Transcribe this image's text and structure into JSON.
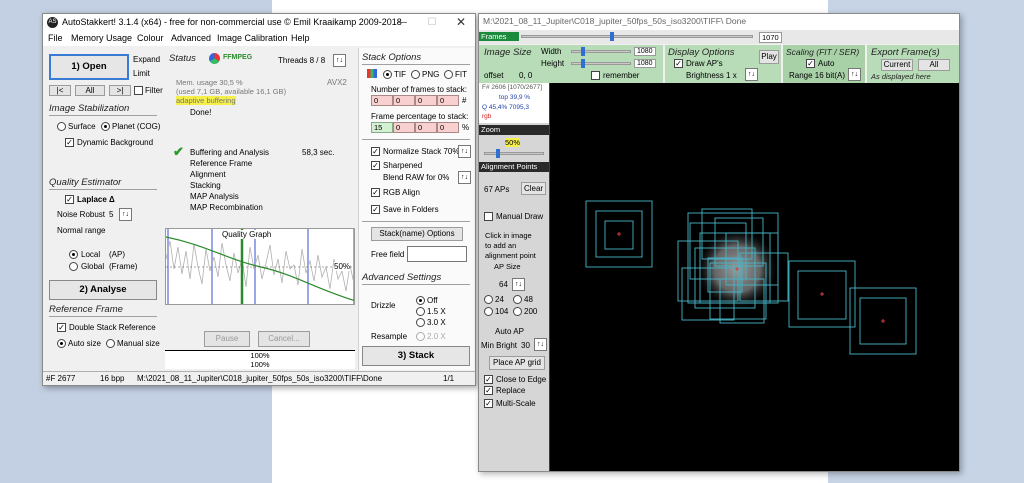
{
  "main": {
    "title": "AutoStakkert! 3.1.4 (x64) - free for non-commercial use © Emil Kraaikamp 2009-2018",
    "icon_label": "AS",
    "menu": [
      "File",
      "Memory Usage",
      "Colour",
      "Advanced",
      "Image Calibration",
      "Help"
    ],
    "open_label": "1) Open",
    "expand_label": "Expand",
    "limit_label": "Limit",
    "nav": [
      "|<",
      "All",
      ">|"
    ],
    "filter_label": "Filter",
    "image_stabilization": {
      "title": "Image Stabilization",
      "surface": "Surface",
      "planet": "Planet (COG)",
      "dynamic_bg": "Dynamic Background"
    },
    "quality_estimator": {
      "title": "Quality Estimator",
      "laplace": "Laplace Δ",
      "noise_robust": "Noise Robust",
      "noise_value": "5",
      "normal_range": "Normal range",
      "local": "Local",
      "local_suffix": "(AP)",
      "global": "Global",
      "global_suffix": "(Frame)"
    },
    "analyse_label": "2) Analyse",
    "reference_frame": {
      "title": "Reference Frame",
      "double_stack": "Double Stack Reference",
      "auto_size": "Auto size",
      "manual_size": "Manual size"
    },
    "status": {
      "title": "Status",
      "ffmpeg": "FFMPEG",
      "threads": "Threads 8 / 8",
      "mem_usage": "Mem. usage 30,5 %",
      "mem_detail": "(used 7,1 GB, available 16,1 GB)",
      "avx": "AVX2",
      "adaptive": "adaptive buffering",
      "done": "Done!",
      "steps": [
        "Buffering and Analysis",
        "Reference Frame",
        "Alignment",
        "Stacking",
        "MAP Analysis",
        "MAP Recombination"
      ],
      "time": "58,3 sec."
    },
    "quality_graph": {
      "title": "Quality Graph",
      "pct_label": "50%"
    },
    "pause_label": "Pause",
    "cancel_label": "Cancel...",
    "progress1": "100%",
    "progress2": "100%",
    "stack_options": {
      "title": "Stack Options",
      "tif": "TIF",
      "png": "PNG",
      "fit": "FIT",
      "num_frames_label": "Number of frames to stack:",
      "num_frames": [
        "0",
        "0",
        "0",
        "0"
      ],
      "hash": "#",
      "pct_label": "Frame percentage to stack:",
      "pct": [
        "15",
        "0",
        "0",
        "0"
      ],
      "pct_sign": "%",
      "normalize": "Normalize Stack 70%",
      "sharpened": "Sharpened",
      "blend_raw": "Blend RAW for  0%",
      "rgb_align": "RGB Align",
      "save_folders": "Save in Folders",
      "stack_name": "Stack(name) Options",
      "free_field": "Free field"
    },
    "advanced": {
      "title": "Advanced Settings",
      "drizzle": "Drizzle",
      "off": "Off",
      "x15": "1.5 X",
      "x30": "3.0 X",
      "resample": "Resample",
      "x20": "2.0 X"
    },
    "stack_label": "3) Stack",
    "statusbar": {
      "frames": "#F 2677",
      "bpp": "16 bpp",
      "path": "M:\\2021_08_11_Jupiter\\C018_jupiter_50fps_50s_iso3200\\TIFF\\",
      "state": "Done",
      "page": "1/1"
    }
  },
  "viewer": {
    "title": "M:\\2021_08_11_Jupiter\\C018_jupiter_50fps_50s_iso3200\\TIFF\\  Done",
    "frames_label": "Frames",
    "frames_value": "1070",
    "image_size": "Image Size",
    "width_label": "Width",
    "width_value": "1080",
    "height_label": "Height",
    "height_value": "1080",
    "offset_label": "offset",
    "offset_value": "0, 0",
    "remember": "remember",
    "display_options": "Display Options",
    "draw_aps": "Draw AP's",
    "play": "Play",
    "brightness": "Brightness 1 x",
    "scaling": "Scaling (FIT / SER)",
    "auto": "Auto",
    "range": "Range 16 bit(A)",
    "export": "Export Frame(s)",
    "current": "Current",
    "all": "All",
    "as_displayed": "As displayed here",
    "frame_info": "F# 2606 [1070/2677]",
    "top_info": "top 39,9 %",
    "q_info": "Q 45,4%  7095,3",
    "rgb": "rgb",
    "zoom": "Zoom",
    "zoom_pct": "50%",
    "alignment_points": "Alignment Points",
    "ap_count": "67 APs",
    "clear": "Clear",
    "manual_draw": "Manual Draw",
    "click_hint": [
      "Click in image",
      "to add an",
      "alignment point"
    ],
    "ap_size_label": "AP Size",
    "ap_size_value": "64",
    "sizes": [
      "24",
      "48",
      "104",
      "200"
    ],
    "auto_ap": "Auto AP",
    "min_bright_label": "Min Bright",
    "min_bright_value": "30",
    "place_grid": "Place AP grid",
    "close_edge": "Close to Edge",
    "replace": "Replace",
    "multi_scale": "Multi-Scale"
  },
  "colors": {
    "accent": "#3a7bd5",
    "panel_green": "#b7dcb7",
    "ap_box": "#46b6c8"
  }
}
